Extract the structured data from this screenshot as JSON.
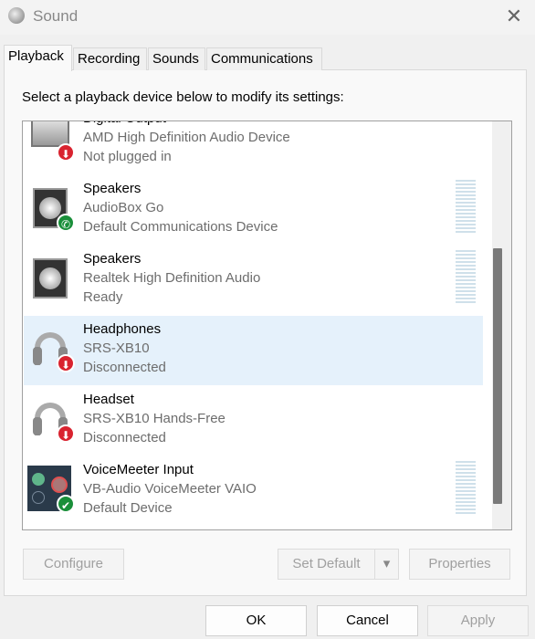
{
  "window": {
    "title": "Sound",
    "close_icon": "close-icon"
  },
  "tabs": [
    {
      "label": "Playback",
      "active": true
    },
    {
      "label": "Recording"
    },
    {
      "label": "Sounds"
    },
    {
      "label": "Communications"
    }
  ],
  "instruction": "Select a playback device below to modify its settings:",
  "devices": [
    {
      "name": "Digital Output",
      "driver": "AMD High Definition Audio Device",
      "status": "Not plugged in",
      "icon": "monitor-icon",
      "badge": "down-arrow"
    },
    {
      "name": "Speakers",
      "driver": "AudioBox Go",
      "status": "Default Communications Device",
      "icon": "speaker-icon",
      "badge": "phone"
    },
    {
      "name": "Speakers",
      "driver": "Realtek High Definition Audio",
      "status": "Ready",
      "icon": "speaker-icon"
    },
    {
      "name": "Headphones",
      "driver": "SRS-XB10",
      "status": "Disconnected",
      "icon": "headphones-icon",
      "badge": "down-arrow",
      "selected": true
    },
    {
      "name": "Headset",
      "driver": "SRS-XB10 Hands-Free",
      "status": "Disconnected",
      "icon": "headset-icon",
      "badge": "down-arrow"
    },
    {
      "name": "VoiceMeeter Input",
      "driver": "VB-Audio VoiceMeeter VAIO",
      "status": "Default Device",
      "icon": "voicemeeter-icon",
      "badge": "check"
    }
  ],
  "buttons": {
    "configure": "Configure",
    "set_default": "Set Default",
    "properties": "Properties",
    "ok": "OK",
    "cancel": "Cancel",
    "apply": "Apply"
  },
  "colors": {
    "selection": "#e5f1fb",
    "badge_red": "#d9232f",
    "badge_green": "#1a8f3a"
  }
}
